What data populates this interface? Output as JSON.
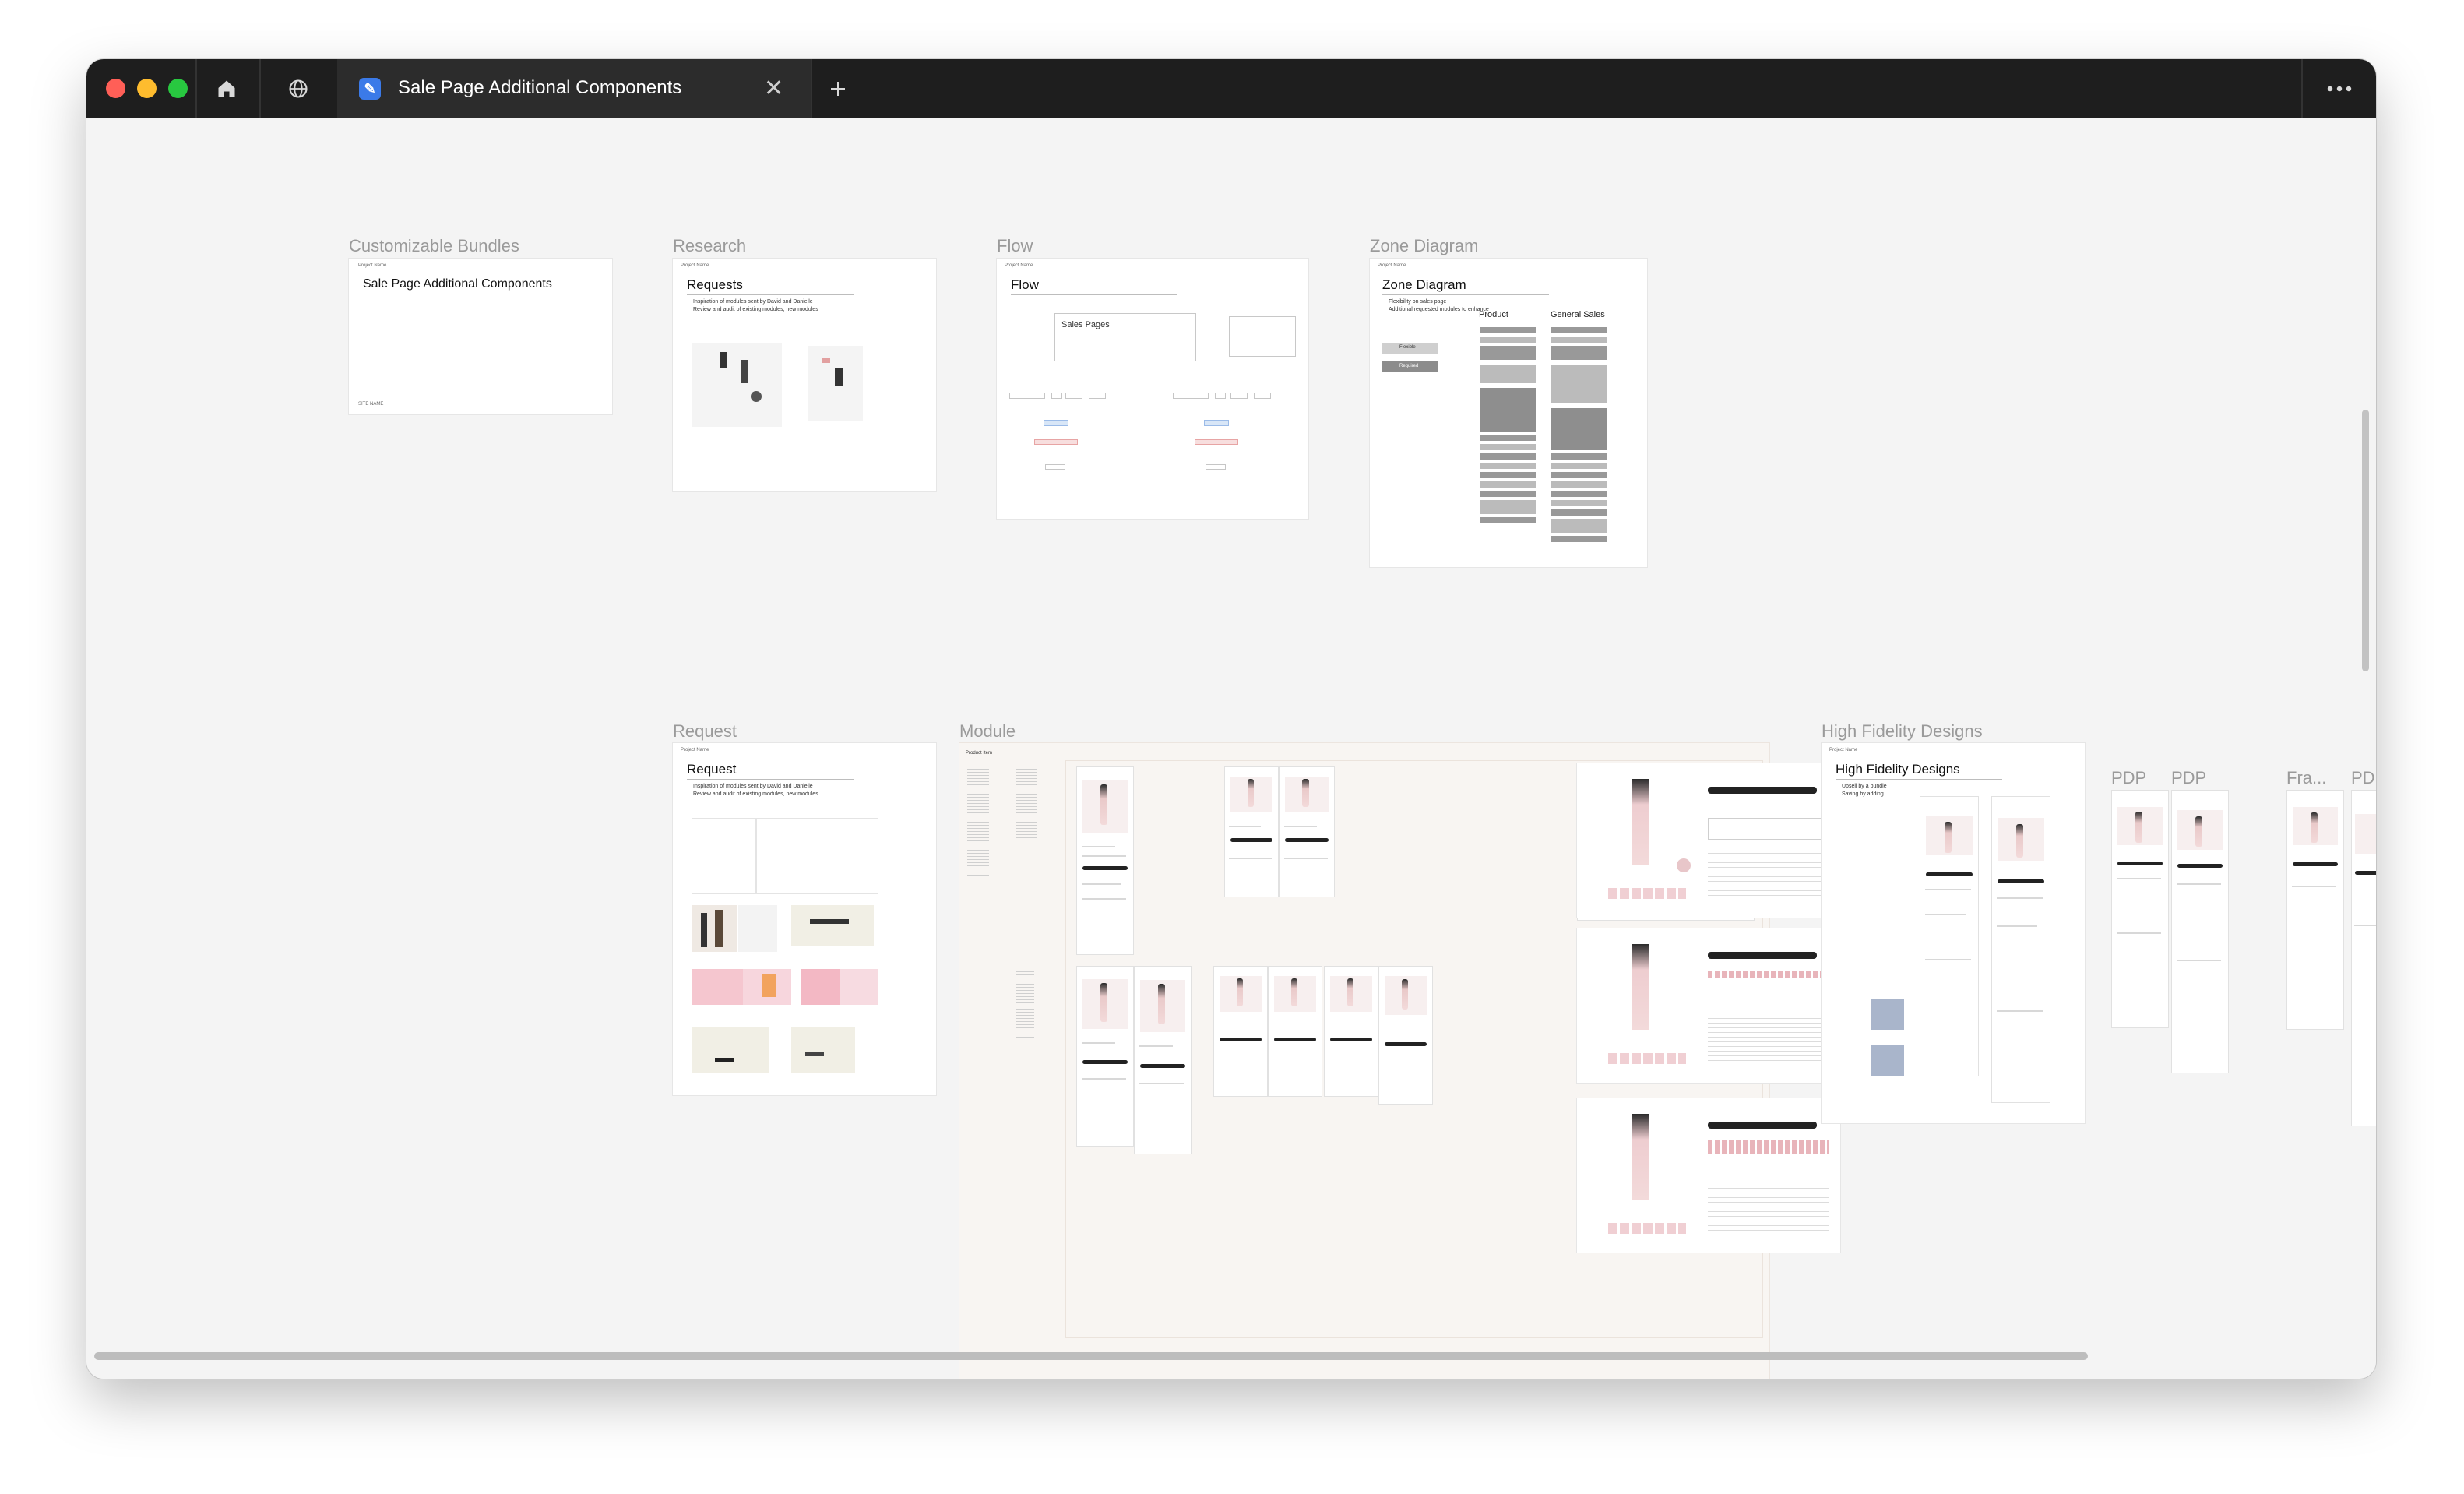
{
  "window": {
    "tab_title": "Sale Page Additional Components",
    "buttons": {
      "home": "home-icon",
      "globe": "globe-icon",
      "close": "close-icon",
      "new_tab": "plus-icon",
      "more": "more-icon"
    },
    "traffic_lights": {
      "close": "#ff5f57",
      "minimize": "#febc2e",
      "maximize": "#28c840"
    }
  },
  "canvas": {
    "labels": {
      "customizable_bundles": "Customizable Bundles",
      "research": "Research",
      "flow": "Flow",
      "zone_diagram": "Zone Diagram",
      "request": "Request",
      "module": "Module",
      "high_fidelity": "High Fidelity Designs",
      "pdp1": "PDP",
      "pdp2": "PDP",
      "fra": "Fra...",
      "pd": "PD"
    },
    "frames": {
      "cover": {
        "title": "Sale Page Additional Components"
      },
      "requests": {
        "title": "Requests",
        "bullets": [
          "Inspiration of modules sent by David and Danielle",
          "Review and audit of existing modules, new modules"
        ]
      },
      "flow": {
        "title": "Flow",
        "box": "Sales Pages"
      },
      "zone": {
        "title": "Zone Diagram",
        "bullets": [
          "Flexibility on sales page",
          "Additional requested modules to enhance"
        ],
        "legend": [
          "Flexible",
          "Required"
        ],
        "col_product": "Product",
        "col_general": "General Sales"
      },
      "request": {
        "title": "Request",
        "bullets": [
          "Inspiration of modules sent by David and Danielle",
          "Review and audit of existing modules, new modules"
        ]
      },
      "module": {
        "title": "Product Item"
      },
      "high_fidelity": {
        "title": "High Fidelity Designs",
        "bullets": [
          "Upsell by a bundle",
          "Saving by adding"
        ]
      }
    }
  }
}
